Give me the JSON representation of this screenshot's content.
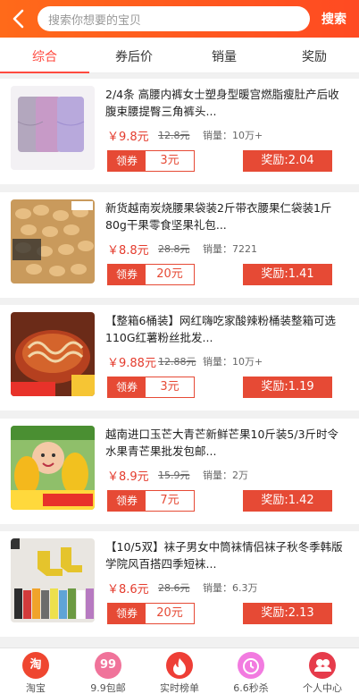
{
  "header": {
    "search_placeholder": "搜索你想要的宝贝",
    "search_button": "搜索"
  },
  "tabs": [
    {
      "label": "综合",
      "active": true
    },
    {
      "label": "券后价",
      "active": false
    },
    {
      "label": "销量",
      "active": false
    },
    {
      "label": "奖励",
      "active": false
    }
  ],
  "products": [
    {
      "title": "2/4条 高腰内裤女士塑身型暖宫燃脂瘦肚产后收腹束腰提臀三角裤头...",
      "price": "￥9.8元",
      "orig": "12.8元",
      "sales": "销量：10万+",
      "coupon_label": "领券",
      "coupon_amount": "3元",
      "reward": "奖励:2.04"
    },
    {
      "title": "新货越南炭烧腰果袋装2斤带衣腰果仁袋装1斤80g干果零食坚果礼包...",
      "price": "￥8.8元",
      "orig": "28.8元",
      "sales": "销量：7221",
      "coupon_label": "领券",
      "coupon_amount": "20元",
      "reward": "奖励:1.41"
    },
    {
      "title": "【整箱6桶装】网红嗨吃家酸辣粉桶装整箱可选110G红薯粉丝批发...",
      "price": "￥9.88元",
      "orig": "12.88元",
      "sales": "销量：10万+",
      "coupon_label": "领券",
      "coupon_amount": "3元",
      "reward": "奖励:1.19"
    },
    {
      "title": "越南进口玉芒大青芒新鲜芒果10斤装5/3斤时令水果青芒果批发包邮...",
      "price": "￥8.9元",
      "orig": "15.9元",
      "sales": "销量：2万",
      "coupon_label": "领券",
      "coupon_amount": "7元",
      "reward": "奖励:1.42"
    },
    {
      "title": "【10/5双】袜子男女中筒袜情侣袜子秋冬季韩版学院风百搭四季短袜...",
      "price": "￥8.6元",
      "orig": "28.6元",
      "sales": "销量：6.3万",
      "coupon_label": "领券",
      "coupon_amount": "20元",
      "reward": "奖励:2.13"
    }
  ],
  "bottom_nav": [
    {
      "label": "淘宝",
      "icon_text": "淘",
      "color": "#ef4630",
      "icon": "taobao-icon"
    },
    {
      "label": "9.9包邮",
      "icon_text": "99",
      "color": "#f0739a",
      "icon": "nine-nine-icon"
    },
    {
      "label": "实时榜单",
      "icon_text": "",
      "color": "#ee3e36",
      "icon": "fire-icon"
    },
    {
      "label": "6.6秒杀",
      "icon_text": "",
      "color": "#f27be0",
      "icon": "clock-icon"
    },
    {
      "label": "个人中心",
      "icon_text": "",
      "color": "#e63b4b",
      "icon": "user-icon"
    }
  ]
}
